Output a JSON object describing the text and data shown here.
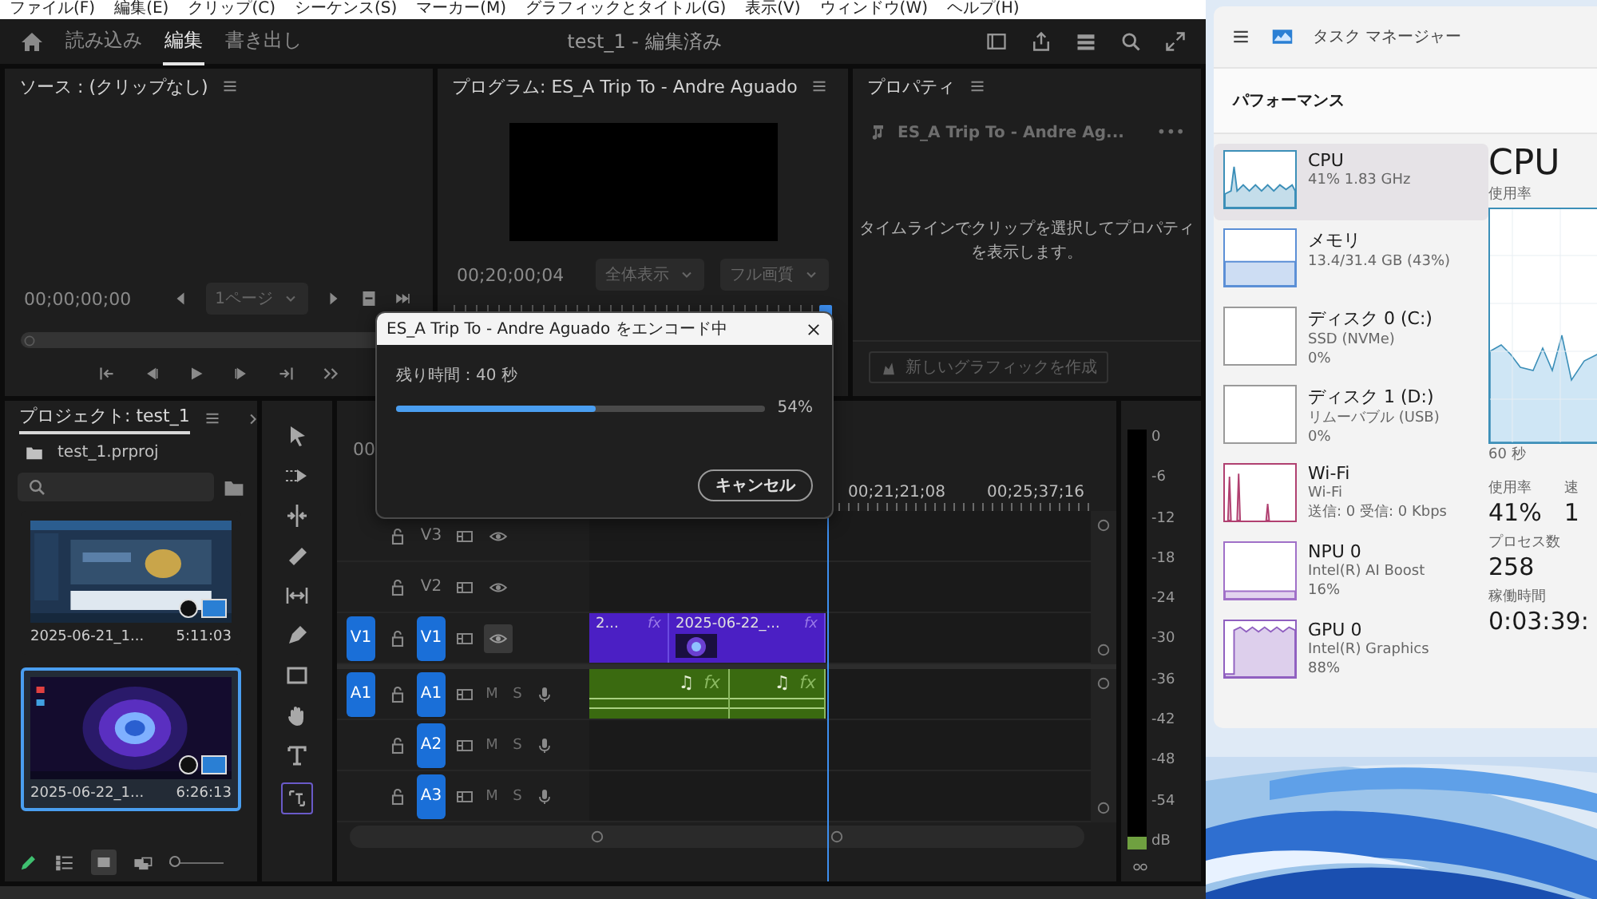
{
  "menu_bar": {
    "items": [
      "ファイル(F)",
      "編集(E)",
      "クリップ(C)",
      "シーケンス(S)",
      "マーカー(M)",
      "グラフィックとタイトル(G)",
      "表示(V)",
      "ウィンドウ(W)",
      "ヘルプ(H)"
    ]
  },
  "header": {
    "tabs": [
      {
        "label": "読み込み",
        "selected": false
      },
      {
        "label": "編集",
        "selected": true
      },
      {
        "label": "書き出し",
        "selected": false
      }
    ],
    "title": "test_1 - 編集済み"
  },
  "source_panel": {
    "title": "ソース : (クリップなし)",
    "timecode": "00;00;00;00",
    "page_dropdown": "1ページ"
  },
  "program_panel": {
    "title": "プログラム: ES_A Trip To - Andre Aguado",
    "timecode": "00;20;00;04",
    "zoom_dropdown": "全体表示",
    "quality_dropdown": "フル画質"
  },
  "properties_panel": {
    "title": "プロパティ",
    "clip_name": "ES_A Trip To - Andre Ag...",
    "more": "•••",
    "message": "タイムラインでクリップを選択してプロパティを表示します。",
    "button": "新しいグラフィックを作成"
  },
  "project_panel": {
    "tab": "プロジェクト: test_1",
    "file": "test_1.prproj",
    "zoom_slider": {
      "level": 0
    },
    "items": [
      {
        "name": "2025-06-21_1...",
        "duration": "5:11:03",
        "selected": false
      },
      {
        "name": "2025-06-22_1...",
        "duration": "6:26:13",
        "selected": true
      }
    ]
  },
  "timeline": {
    "timecode": "00",
    "ruler": [
      "00;21;21;08",
      "00;25;37;16"
    ],
    "tracks": [
      {
        "name": "V3",
        "kind": "video",
        "targeted": false,
        "eye_active": false
      },
      {
        "name": "V2",
        "kind": "video",
        "targeted": false,
        "eye_active": false
      },
      {
        "name": "V1",
        "kind": "video",
        "targeted": true,
        "eye_active": true,
        "source": "V1",
        "clips": [
          {
            "label": "2...",
            "fx": "fx",
            "thumbnail": false
          },
          {
            "label": "2025-06-22_...",
            "fx": "fx",
            "thumbnail": true
          }
        ]
      },
      {
        "name": "A1",
        "kind": "audio",
        "targeted": true,
        "source": "A1",
        "mute": "M",
        "solo": "S",
        "clips": [
          {
            "note": "♫",
            "fx": "fx"
          },
          {
            "note": "♫",
            "fx": "fx"
          }
        ]
      },
      {
        "name": "A2",
        "kind": "audio",
        "targeted": true,
        "mute": "M",
        "solo": "S"
      },
      {
        "name": "A3",
        "kind": "audio",
        "targeted": true,
        "mute": "M",
        "solo": "S"
      }
    ]
  },
  "audio_meter": {
    "scale": [
      "0",
      "-6",
      "-12",
      "-18",
      "-24",
      "-30",
      "-36",
      "-42",
      "-48",
      "-54"
    ],
    "unit": "dB"
  },
  "encode_dialog": {
    "title": "ES_A Trip To - Andre Aguado をエンコード中",
    "remaining": "残り時間：40 秒",
    "level": 0.54,
    "percent": "54%",
    "cancel": "キャンセル"
  },
  "task_manager": {
    "title": "タスク マネージャー",
    "section": "パフォーマンス",
    "resources": [
      {
        "name": "CPU",
        "lines": [
          "41%  1.83 GHz"
        ],
        "color": "#3c8fb8",
        "selected": true
      },
      {
        "name": "メモリ",
        "lines": [
          "13.4/31.4 GB (43%)"
        ],
        "color": "#5b8fd6",
        "selected": false
      },
      {
        "name": "ディスク 0 (C:)",
        "lines": [
          "SSD (NVMe)",
          "0%"
        ],
        "color": "#9a9a9a",
        "selected": false
      },
      {
        "name": "ディスク 1 (D:)",
        "lines": [
          "リムーバブル (USB)",
          "0%"
        ],
        "color": "#9a9a9a",
        "selected": false
      },
      {
        "name": "Wi-Fi",
        "lines": [
          "Wi-Fi",
          "送信: 0 受信: 0 Kbps"
        ],
        "color": "#b04070",
        "selected": false
      },
      {
        "name": "NPU 0",
        "lines": [
          "Intel(R) AI Boost",
          "16%"
        ],
        "color": "#a070c8",
        "selected": false
      },
      {
        "name": "GPU 0",
        "lines": [
          "Intel(R) Graphics",
          "88%"
        ],
        "color": "#9060c0",
        "selected": false
      }
    ],
    "detail": {
      "title": "CPU",
      "chart_label": "使用率",
      "time_span": "60 秒",
      "stats": [
        {
          "label": "使用率",
          "value": "41%"
        },
        {
          "label": "速",
          "value": "1"
        },
        {
          "label": "プロセス数",
          "value": "258"
        },
        {
          "label": "稼働時間",
          "value": "0:03:39:"
        }
      ]
    }
  }
}
